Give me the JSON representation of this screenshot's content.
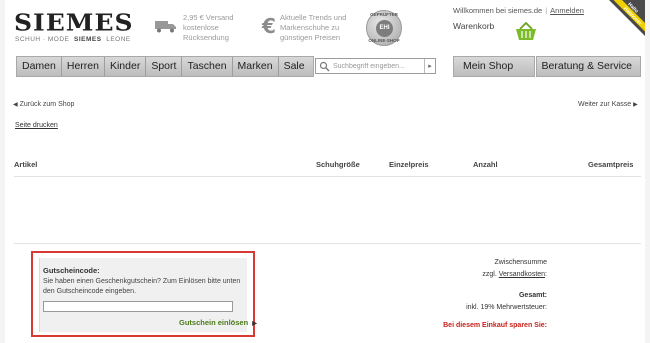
{
  "header": {
    "logo": "SIEMES",
    "logo_sub_brands": [
      "SCHUH · MODE",
      "SIEMES",
      "LEONE"
    ],
    "shipping_info": "2,95 € Versand kostenlose Rücksendung",
    "shipping_lines": [
      "2,95 € Versand",
      "kostenlose",
      "Rücksendung"
    ],
    "trend_lines": [
      "Aktuelle Trends und",
      "Markenschuhe zu",
      "günstigen Preisen"
    ],
    "seal_top": "GEPRÜFTER",
    "seal_center": "EHI",
    "seal_bottom": "ONLINE-SHOP",
    "welcome": "Willkommen bei siemes.de",
    "login": "Anmelden",
    "cart": "Warenkorb",
    "ribbon": "Hallo Hannover"
  },
  "nav": {
    "items": [
      "Damen",
      "Herren",
      "Kinder",
      "Sport",
      "Taschen",
      "Marken",
      "Sale"
    ],
    "search_placeholder": "Suchbegriff eingeben...",
    "my_shop": "Mein Shop",
    "service": "Beratung & Service"
  },
  "page": {
    "back": "Zurück zum Shop",
    "forward": "Weiter zur Kasse",
    "print": "Seite drucken"
  },
  "table": {
    "headers": [
      "Artikel",
      "Schuhgröße",
      "Einzelpreis",
      "Anzahl",
      "Gesamtpreis"
    ]
  },
  "coupon": {
    "title": "Gutscheincode:",
    "description": "Sie haben einen Geschenkgutschein? Zum Einlösen bitte unten den Gutscheincode eingeben.",
    "input_value": "",
    "button": "Gutschein einlösen"
  },
  "totals": {
    "subtotal": "Zwischensumme",
    "shipping_prefix": "zzgl.",
    "shipping_link": "Versandkosten",
    "shipping_suffix": ":",
    "total": "Gesamt:",
    "vat": "inkl. 19% Mehrwertsteuer:",
    "savings": "Bei diesem Einkauf sparen Sie:"
  },
  "colors": {
    "accent_green": "#4b7a1a",
    "highlight_red": "#d63a33",
    "savings_red": "#c8201c",
    "nav_gray": "#c9c9c9"
  },
  "icons": [
    "truck-icon",
    "euro-icon",
    "basket-icon",
    "search-icon",
    "arrow-left-icon",
    "arrow-right-icon"
  ]
}
